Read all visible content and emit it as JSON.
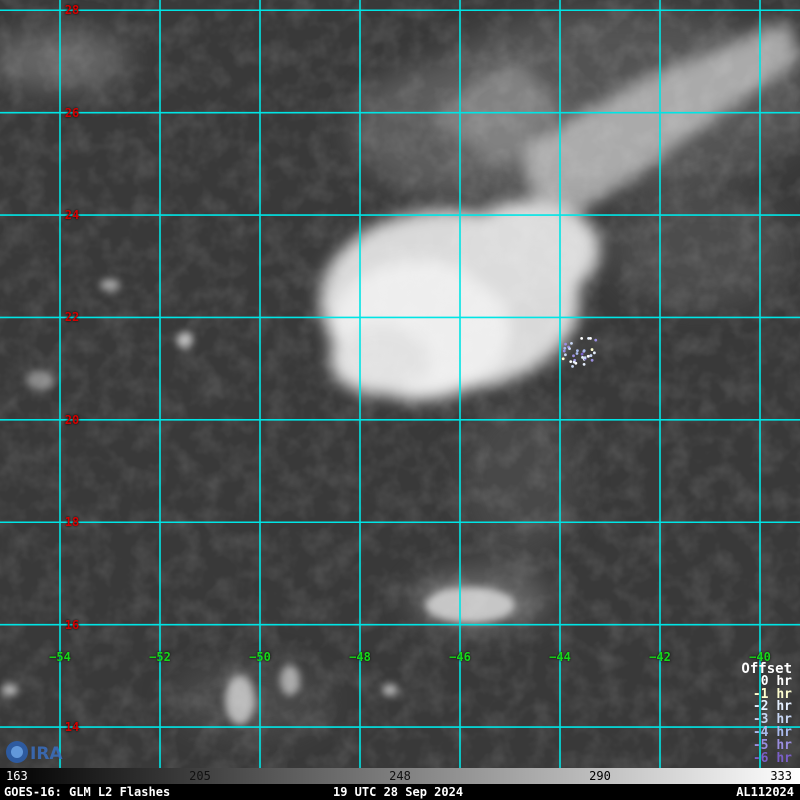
{
  "map": {
    "lat_labels": [
      {
        "value": "28",
        "lat": 28
      },
      {
        "value": "26",
        "lat": 26
      },
      {
        "value": "24",
        "lat": 24
      },
      {
        "value": "22",
        "lat": 22
      },
      {
        "value": "20",
        "lat": 20
      },
      {
        "value": "18",
        "lat": 18
      },
      {
        "value": "16",
        "lat": 16
      },
      {
        "value": "14",
        "lat": 14
      }
    ],
    "lon_labels": [
      {
        "value": "−54",
        "lon": -54
      },
      {
        "value": "−52",
        "lon": -52
      },
      {
        "value": "−50",
        "lon": -50
      },
      {
        "value": "−48",
        "lon": -48
      },
      {
        "value": "−46",
        "lon": -46
      },
      {
        "value": "−44",
        "lon": -44
      },
      {
        "value": "−42",
        "lon": -42
      },
      {
        "value": "−40",
        "lon": -40
      }
    ],
    "lat_range": [
      13.2,
      28.2
    ],
    "lon_range": [
      -55.2,
      -39.2
    ],
    "grid_color": "#00e5e5",
    "lat_label_color": "#d40000",
    "lon_label_color": "#18d818"
  },
  "legend": {
    "title": "Offset",
    "entries": [
      {
        "label": "0 hr",
        "color": "#ffffff"
      },
      {
        "label": "-1 hr",
        "color": "#ffffd0"
      },
      {
        "label": "-2 hr",
        "color": "#e6f0ff"
      },
      {
        "label": "-3 hr",
        "color": "#c8d7f5"
      },
      {
        "label": "-4 hr",
        "color": "#aabbee"
      },
      {
        "label": "-5 hr",
        "color": "#9a8ee0"
      },
      {
        "label": "-6 hr",
        "color": "#7a5fc8"
      }
    ]
  },
  "colorbar": {
    "ticks": [
      "163",
      "205",
      "248",
      "290",
      "333"
    ]
  },
  "footer": {
    "left": "GOES-16: GLM L2 Flashes",
    "center": "19 UTC 28 Sep 2024",
    "right": "AL112024"
  },
  "logo": {
    "text": "CIRA",
    "icon": "cira-logo"
  }
}
